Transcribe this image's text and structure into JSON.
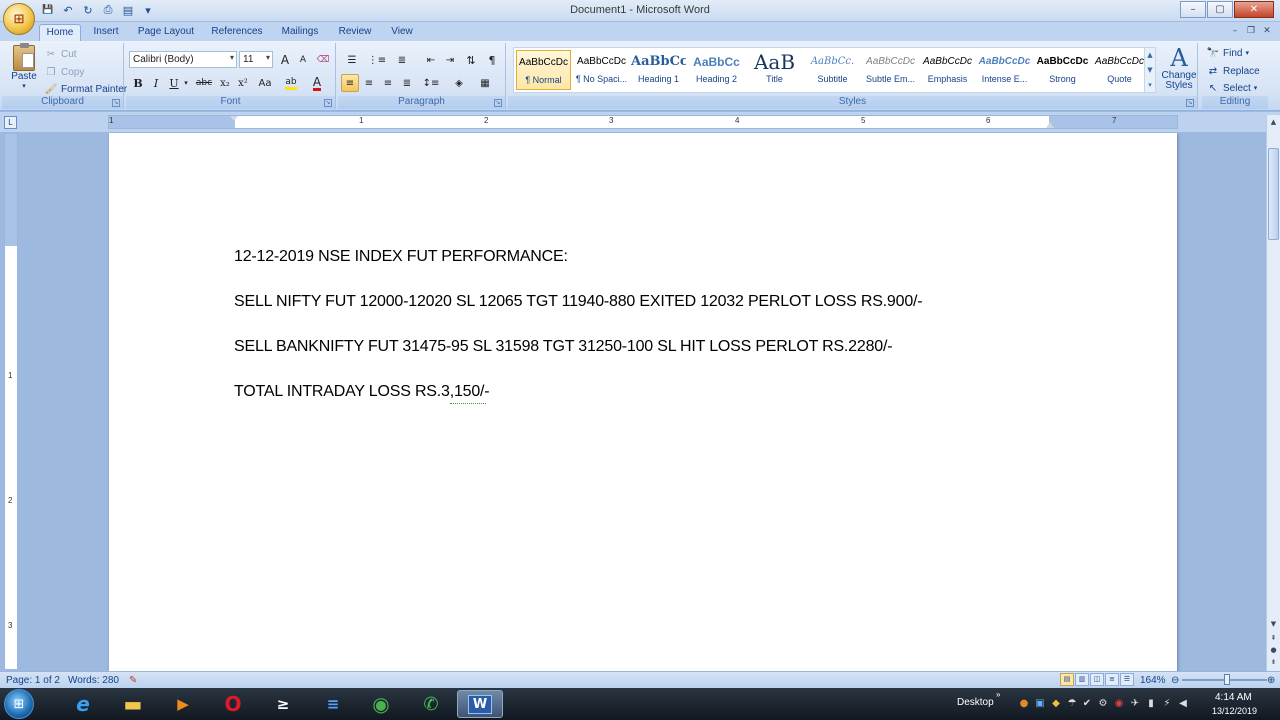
{
  "window": {
    "title": "Document1 - Microsoft Word"
  },
  "office_button": {
    "glyph": "⊞"
  },
  "quick_access": {
    "save": "💾",
    "undo": "↶",
    "redo": "↻",
    "print": "⎙",
    "preview": "▤",
    "customize": "▾"
  },
  "window_controls": {
    "minimize": "–",
    "maximize": "▢",
    "close": "✕"
  },
  "doc_controls": {
    "minimize": "–",
    "restore": "❐",
    "close": "✕"
  },
  "tabs": [
    "Home",
    "Insert",
    "Page Layout",
    "References",
    "Mailings",
    "Review",
    "View"
  ],
  "ribbon": {
    "clipboard": {
      "label": "Clipboard",
      "paste": "Paste",
      "cut": "Cut",
      "copy": "Copy",
      "format_painter": "Format Painter"
    },
    "font": {
      "label": "Font",
      "font_name": "Calibri (Body)",
      "font_size": "11",
      "bold": "B",
      "italic": "I",
      "underline": "U",
      "strike": "abc",
      "subscript": "x₂",
      "superscript": "x²",
      "change_case": "Aa",
      "grow": "A",
      "shrink": "A",
      "clear": "⌫",
      "highlight": "ab",
      "font_color": "A"
    },
    "paragraph": {
      "label": "Paragraph"
    },
    "styles": {
      "label": "Styles",
      "change_styles": "Change Styles",
      "items": [
        {
          "sample": "AaBbCcDc",
          "name": "¶ Normal"
        },
        {
          "sample": "AaBbCcDc",
          "name": "¶ No Spaci..."
        },
        {
          "sample": "AaBbCc",
          "name": "Heading 1"
        },
        {
          "sample": "AaBbCc",
          "name": "Heading 2"
        },
        {
          "sample": "AaB",
          "name": "Title"
        },
        {
          "sample": "AaBbCc.",
          "name": "Subtitle"
        },
        {
          "sample": "AaBbCcDc",
          "name": "Subtle Em..."
        },
        {
          "sample": "AaBbCcDc",
          "name": "Emphasis"
        },
        {
          "sample": "AaBbCcDc",
          "name": "Intense E..."
        },
        {
          "sample": "AaBbCcDc",
          "name": "Strong"
        },
        {
          "sample": "AaBbCcDc",
          "name": "Quote"
        }
      ]
    },
    "editing": {
      "label": "Editing",
      "find": "Find",
      "replace": "Replace",
      "select": "Select"
    }
  },
  "ruler": {
    "numbers": [
      "1",
      "1",
      "2",
      "3",
      "4",
      "5",
      "6",
      "7"
    ]
  },
  "vruler": {
    "numbers": [
      "1",
      "2",
      "3"
    ]
  },
  "document": {
    "lines": [
      "12-12-2019 NSE INDEX FUT PERFORMANCE:",
      "SELL NIFTY FUT 12000-12020 SL 12065 TGT 11940-880 EXITED 12032 PERLOT LOSS RS.900/-",
      "SELL BANKNIFTY FUT 31475-95 SL 31598 TGT 31250-100 SL HIT LOSS PERLOT RS.2280/-",
      "TOTAL INTRADAY LOSS RS.3,150/-"
    ]
  },
  "status": {
    "page": "Page: 1 of 2",
    "words": "Words: 280",
    "zoom": "164%"
  },
  "taskbar": {
    "start": "⊞",
    "apps": [
      {
        "name": "ie",
        "glyph": "e",
        "color": "#3aa0f0"
      },
      {
        "name": "explorer",
        "glyph": "▬",
        "color": "#f3c64c"
      },
      {
        "name": "media",
        "glyph": "▶",
        "color": "#f08a1c"
      },
      {
        "name": "opera",
        "glyph": "O",
        "color": "#e0182a"
      },
      {
        "name": "app5",
        "glyph": "≥",
        "color": "#ffffff"
      },
      {
        "name": "app6",
        "glyph": "≡",
        "color": "#5aa0ff"
      },
      {
        "name": "chrome",
        "glyph": "◉",
        "color": "#4caf50"
      },
      {
        "name": "whatsapp",
        "glyph": "✆",
        "color": "#43c553"
      },
      {
        "name": "word",
        "glyph": "W",
        "color": "#2b5ca8"
      }
    ],
    "desktop_label": "Desktop",
    "time": "4:14 AM",
    "date": "13/12/2019"
  }
}
